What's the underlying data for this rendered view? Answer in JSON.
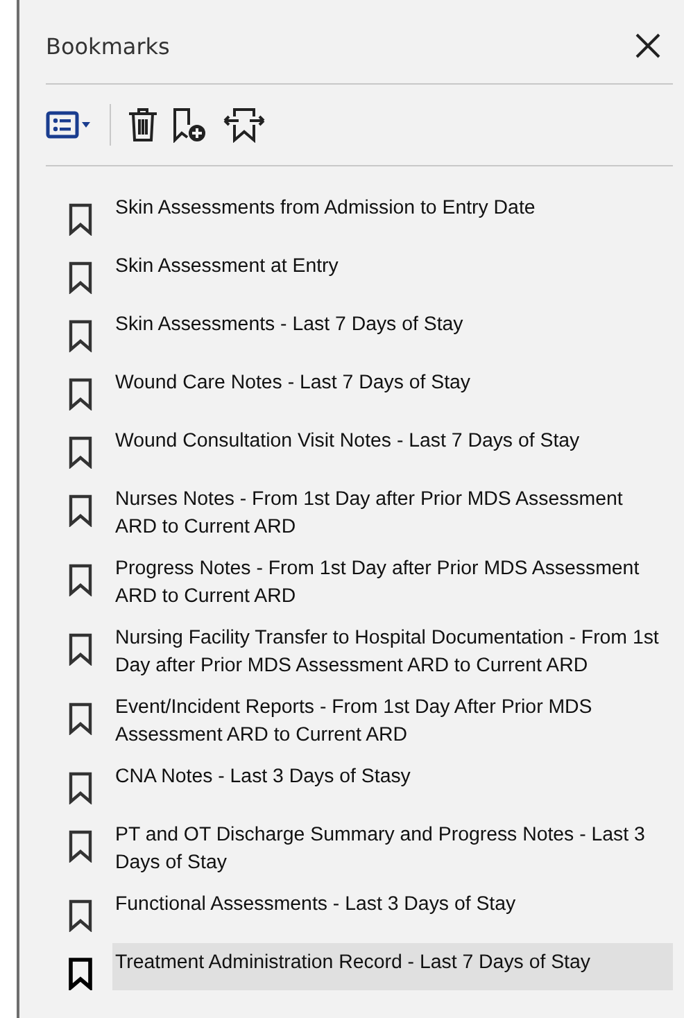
{
  "panel": {
    "title": "Bookmarks"
  },
  "toolbar": [
    {
      "kind": "options"
    },
    {
      "kind": "separator"
    },
    {
      "kind": "delete"
    },
    {
      "kind": "add"
    },
    {
      "kind": "expand"
    }
  ],
  "bookmarks": [
    {
      "label": "Skin Assessments from Admission to Entry Date",
      "selected": false
    },
    {
      "label": "Skin Assessment at Entry",
      "selected": false
    },
    {
      "label": "Skin Assessments - Last 7 Days of Stay",
      "selected": false
    },
    {
      "label": "Wound Care Notes - Last 7 Days of Stay",
      "selected": false
    },
    {
      "label": "Wound Consultation Visit Notes - Last 7 Days of Stay",
      "selected": false
    },
    {
      "label": "Nurses Notes - From 1st Day after Prior MDS Assessment ARD to Current ARD",
      "selected": false
    },
    {
      "label": "Progress Notes - From 1st Day after Prior MDS Assessment ARD to Current ARD",
      "selected": false
    },
    {
      "label": "Nursing Facility Transfer to Hospital Documentation - From 1st Day after Prior MDS Assessment ARD to Current ARD",
      "selected": false
    },
    {
      "label": "Event/Incident Reports - From 1st Day After Prior MDS Assessment ARD to Current ARD",
      "selected": false
    },
    {
      "label": "CNA Notes - Last 3 Days of Stasy",
      "selected": false
    },
    {
      "label": "PT and OT Discharge Summary and Progress Notes - Last 3 Days of Stay",
      "selected": false
    },
    {
      "label": "Functional Assessments - Last 3 Days of Stay",
      "selected": false
    },
    {
      "label": "Treatment Administration Record - Last 7 Days of Stay",
      "selected": true
    }
  ]
}
